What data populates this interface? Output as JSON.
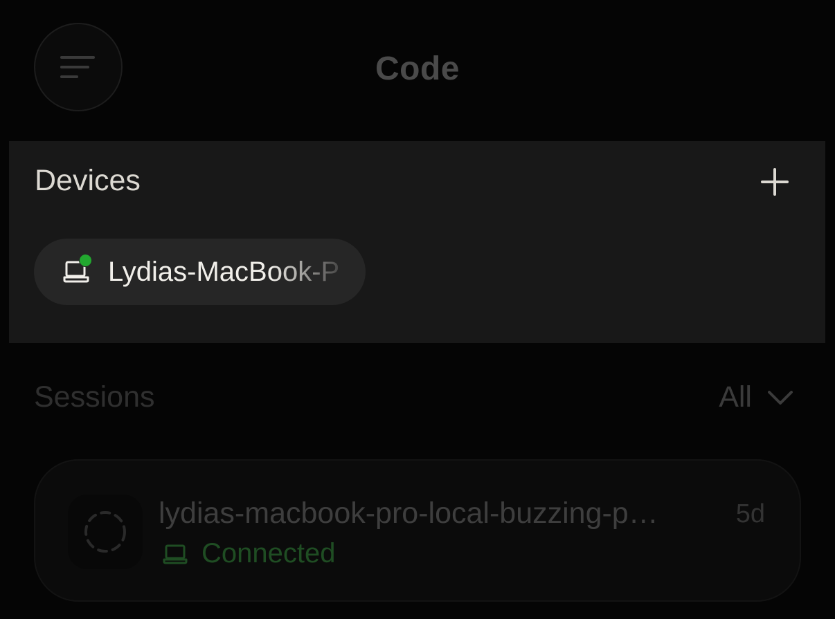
{
  "header": {
    "title": "Code",
    "menu_icon": "menu-lines-icon"
  },
  "devices": {
    "title": "Devices",
    "add_icon": "plus-icon",
    "items": [
      {
        "name": "Lydias-MacBook-Pro",
        "icon": "laptop-icon",
        "status": "online",
        "status_color": "#22a82f"
      }
    ]
  },
  "sessions": {
    "title": "Sessions",
    "filter": {
      "selected": "All",
      "icon": "chevron-down-icon"
    },
    "items": [
      {
        "name": "lydias-macbook-pro-local-buzzing-p…",
        "age": "5d",
        "status": "Connected",
        "status_color": "#1f4d23",
        "icon": "loading-circle-icon"
      }
    ]
  }
}
